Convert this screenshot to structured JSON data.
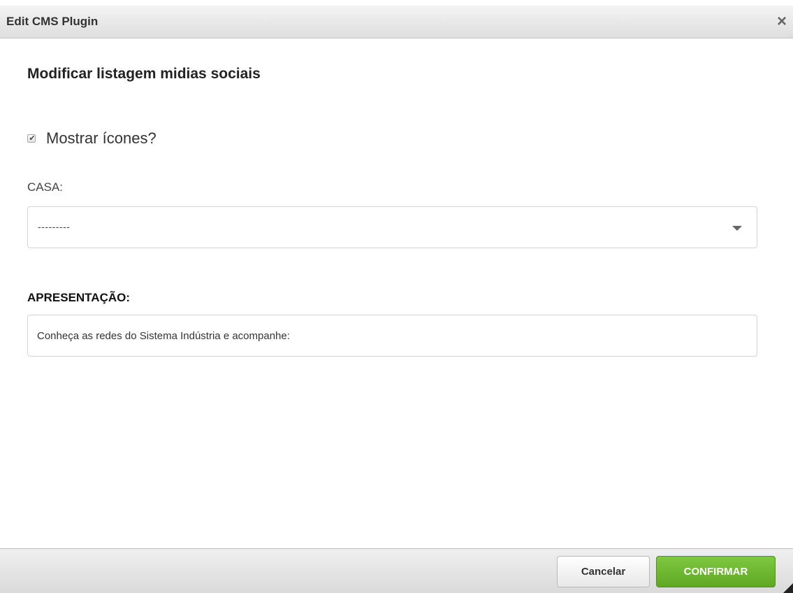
{
  "dialog": {
    "title": "Edit CMS Plugin",
    "close_glyph": "×"
  },
  "form": {
    "heading": "Modificar listagem midias sociais",
    "show_icons": {
      "label": "Mostrar ícones?",
      "checked": true
    },
    "casa": {
      "label": "CASA:",
      "selected": "---------"
    },
    "apresentacao": {
      "label": "APRESENTAÇÃO:",
      "value": "Conheça as redes do Sistema Indústria e acompanhe:"
    }
  },
  "footer": {
    "cancel_label": "Cancelar",
    "confirm_label": "CONFIRMAR"
  },
  "colors": {
    "confirm": "#6bb52f",
    "titlebar": "#e6e6e6"
  }
}
